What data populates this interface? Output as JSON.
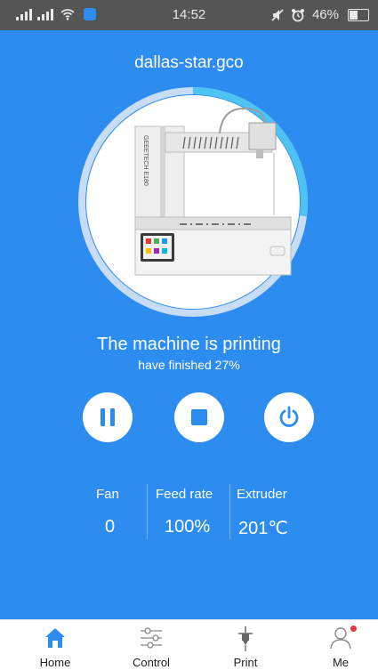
{
  "status_bar": {
    "time": "14:52",
    "battery": "46%"
  },
  "header": {
    "file_name": "dallas-star.gco"
  },
  "printer": {
    "brand_text": "GEEETECH E180",
    "progress": 0.27
  },
  "status": {
    "title": "The machine is printing",
    "subtitle": "have finished 27%"
  },
  "controls": {
    "pause_icon": "pause-icon",
    "stop_icon": "stop-icon",
    "power_icon": "power-icon"
  },
  "stats": {
    "fan_label": "Fan",
    "fan_value": "0",
    "feed_label": "Feed rate",
    "feed_value": "100%",
    "extruder_label": "Extruder",
    "extruder_value": "201℃"
  },
  "nav": {
    "home": "Home",
    "control": "Control",
    "print": "Print",
    "me": "Me"
  },
  "colors": {
    "primary": "#2d8cf0",
    "ring_track": "#c7dcf5",
    "ring_progress": "#4cc3f2",
    "status_bar": "#555555",
    "notification_dot": "#e53935"
  }
}
